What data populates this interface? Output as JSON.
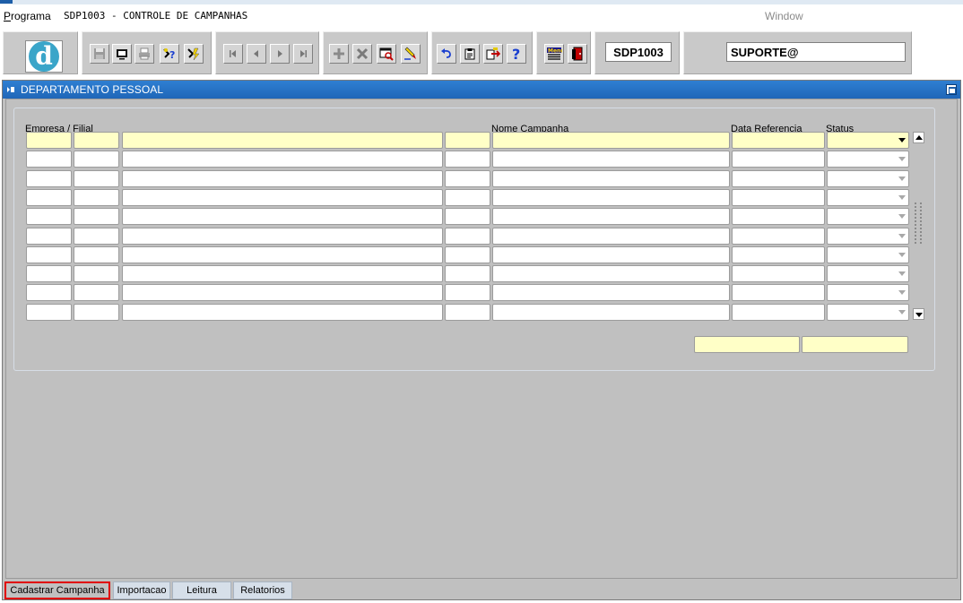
{
  "menubar": {
    "programa_label": "Programa",
    "screen_title": "SDP1003 - CONTROLE DE CAMPANHAS",
    "window_label": "Window"
  },
  "toolbar": {
    "logo_glyph": "d",
    "program_code": "SDP1003",
    "user": "SUPORTE@",
    "buttons": [
      "save-icon",
      "screen-icon",
      "print-icon",
      "query-help-icon",
      "execute-query-icon",
      "first-record-icon",
      "previous-record-icon",
      "next-record-icon",
      "last-record-icon",
      "insert-record-icon",
      "delete-record-icon",
      "lov-icon",
      "edit-icon",
      "undo-icon",
      "clipboard-icon",
      "export-icon",
      "help-icon",
      "menu-icon",
      "exit-icon"
    ]
  },
  "window": {
    "title": "DEPARTAMENTO PESSOAL"
  },
  "grid": {
    "headers": {
      "empresa_filial": "Empresa / Filial",
      "nome_campanha": "Nome Campanha",
      "data_referencia": "Data Referencia",
      "status": "Status"
    },
    "row_count": 10
  },
  "tabs": {
    "cadastrar": "Cadastrar Campanha",
    "importacao": "Importacao",
    "leitura": "Leitura",
    "relatorios": "Relatorios"
  },
  "colors": {
    "title_bar": "#1f66b8",
    "current_row": "#ffffc7",
    "active_tab_outline": "#e00000",
    "form_background": "#c0c0c0"
  }
}
